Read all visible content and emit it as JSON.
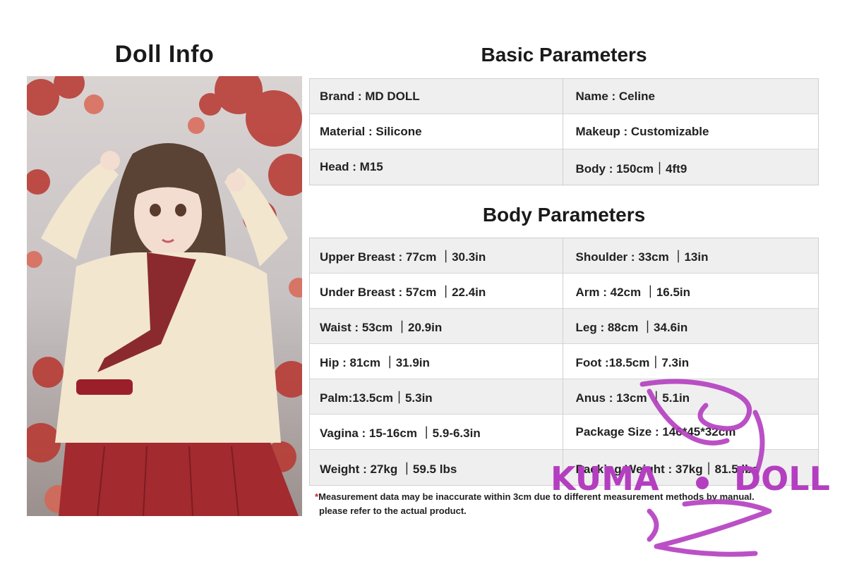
{
  "left": {
    "title": "Doll  Info"
  },
  "basic": {
    "title": "Basic Parameters",
    "rows": [
      [
        "Brand : MD DOLL",
        "Name : Celine"
      ],
      [
        "Material : Silicone",
        "Makeup : Customizable"
      ],
      [
        "Head :  M15",
        "Body : 150cm｜4ft9"
      ]
    ]
  },
  "body": {
    "title": "Body Parameters",
    "rows": [
      [
        "Upper Breast : 77cm ｜30.3in",
        "Shoulder : 33cm ｜13in"
      ],
      [
        "Under Breast : 57cm ｜22.4in",
        "Arm : 42cm ｜16.5in"
      ],
      [
        "Waist : 53cm ｜20.9in",
        "Leg : 88cm ｜34.6in"
      ],
      [
        "Hip : 81cm ｜31.9in",
        "Foot :18.5cm｜7.3in"
      ],
      [
        "Palm:13.5cm｜5.3in",
        "Anus : 13cm ｜5.1in"
      ],
      [
        "Vagina : 15-16cm ｜5.9-6.3in",
        "Package Size : 146*45*32cm"
      ],
      [
        "Weight : 27kg ｜59.5 lbs",
        "Packing Weight : 37kg｜81.5 lbs"
      ]
    ]
  },
  "note": {
    "star": "*",
    "line1": "Measurement data may be inaccurate within 3cm due to different measurement methods by manual.",
    "line2": "please refer to the actual product."
  },
  "watermark": {
    "text": "KUMA DOLL",
    "color": "#b43ec0"
  },
  "colors": {
    "row_shade": "#efefef",
    "border": "#cfcfcf",
    "accent_red": "#a32a2e"
  }
}
